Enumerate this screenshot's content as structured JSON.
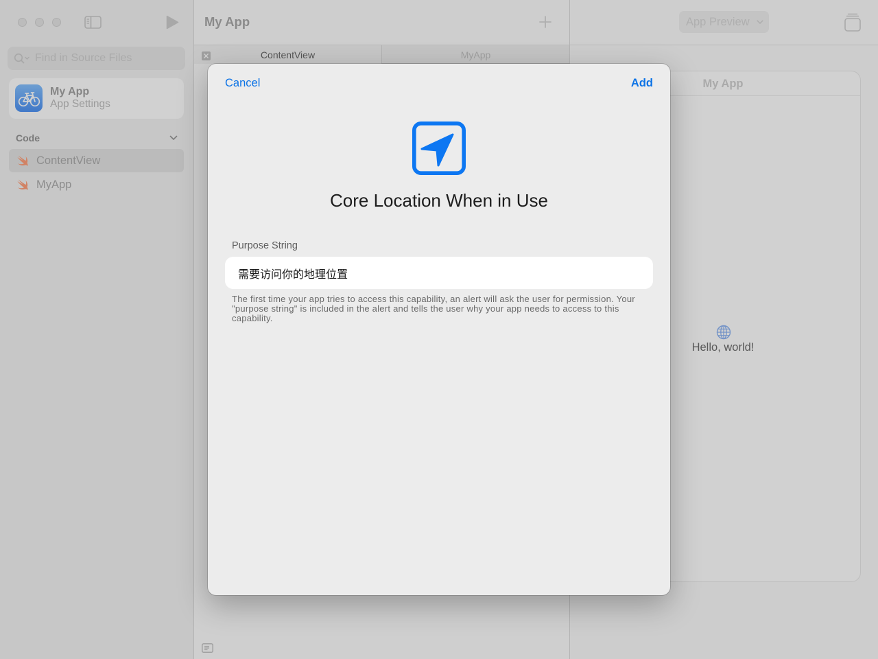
{
  "sidebar": {
    "search": {
      "placeholder": "Find in Source Files",
      "icon": "magnifying-glass-icon"
    },
    "app_card": {
      "name": "My App",
      "subtitle": "App Settings",
      "icon": "bicycle-app-icon"
    },
    "code_section": {
      "title": "Code",
      "items": [
        {
          "label": "ContentView",
          "icon": "swift-icon",
          "selected": true
        },
        {
          "label": "MyApp",
          "icon": "swift-icon",
          "selected": false
        }
      ]
    }
  },
  "editor": {
    "title": "My App",
    "tabs": [
      {
        "label": "ContentView",
        "active": true
      },
      {
        "label": "MyApp",
        "active": false
      }
    ]
  },
  "preview": {
    "menu_label": "App Preview",
    "app_title": "My App",
    "content_icon": "globe-icon",
    "content_text": "Hello, world!"
  },
  "modal": {
    "cancel_label": "Cancel",
    "add_label": "Add",
    "icon": "location-square-icon",
    "title": "Core Location When in Use",
    "field_label": "Purpose String",
    "field_value": "需要访问你的地理位置",
    "help_text": "The first time your app tries to access this capability, an alert will ask the user for permission. Your \"purpose string\" is included in the alert and tells the user why your app needs to access to this capability."
  },
  "colors": {
    "accent": "#0c73e6",
    "modal_background": "#ececec"
  }
}
